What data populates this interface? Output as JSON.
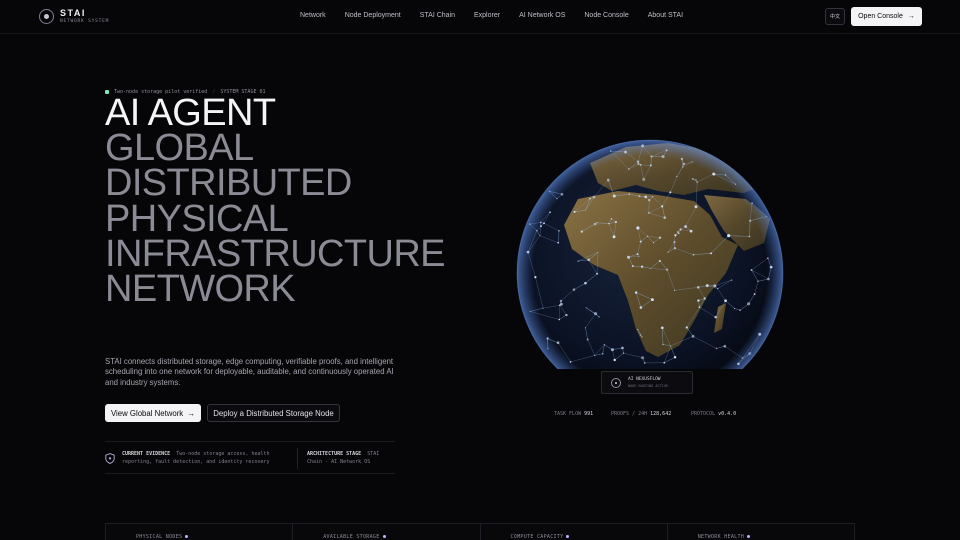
{
  "brand": {
    "name": "STAI",
    "tagline": "NETWORK SYSTEM"
  },
  "nav": {
    "items": [
      "Network",
      "Node Deployment",
      "STAI Chain",
      "Explorer",
      "AI Network OS",
      "Node Console",
      "About STAI"
    ],
    "language_label": "中文",
    "console_label": "Open Console",
    "console_arrow": "→"
  },
  "hero": {
    "badge_status": "Two-node storage pilot verified",
    "badge_separator": "/",
    "badge_stage": "SYSTEM STAGE 01",
    "headline_lines": [
      "AI AGENT",
      "GLOBAL",
      "DISTRIBUTED",
      "PHYSICAL",
      "INFRASTRUCTURE",
      "NETWORK"
    ],
    "description": "STAI connects distributed storage, edge computing, verifiable proofs, and intelligent scheduling into one network for deployable, auditable, and continuously operated AI and industry systems.",
    "primary_cta": "View Global Network",
    "primary_cta_arrow": "→",
    "secondary_cta": "Deploy a Distributed Storage Node"
  },
  "evidence": {
    "current_title": "CURRENT EVIDENCE",
    "current_text": "Two-node storage access, health reporting, fault detection, and identity recovery",
    "stage_title": "ARCHITECTURE STAGE",
    "stage_text": "STAI Chain · AI Network OS"
  },
  "globe": {
    "label_title": "AI NEXUSFLOW",
    "label_sub": "NODE ROUTING ACTIVE",
    "telemetry": {
      "task_flow_label": "TASK FLOW",
      "task_flow_value": "991",
      "proofs_label": "PROOFS / 24H",
      "proofs_value": "128,642",
      "protocol_label": "PROTOCOL",
      "protocol_value": "v0.4.0"
    },
    "colors": {
      "ocean": "#0a1020",
      "land": "#6b5532",
      "nodes": "#cfe6ff",
      "links": "#9cc6ff"
    }
  },
  "stats": [
    "PHYSICAL NODES",
    "AVAILABLE STORAGE",
    "COMPUTE CAPACITY",
    "NETWORK HEALTH"
  ]
}
